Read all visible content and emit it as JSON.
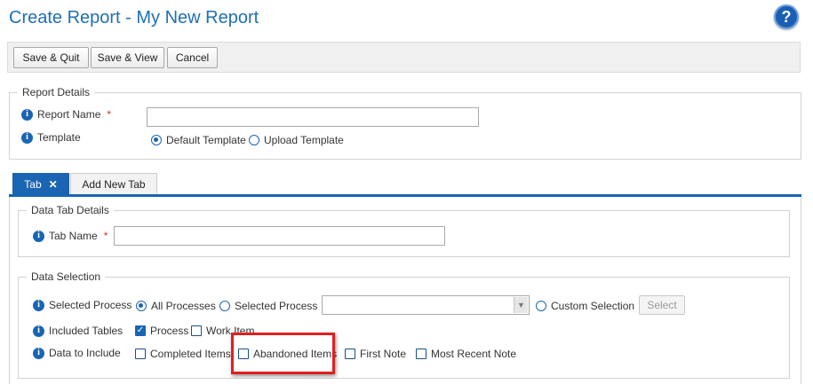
{
  "header": {
    "title": "Create Report - My New Report",
    "help_label": "?"
  },
  "toolbar": {
    "save_quit": "Save & Quit",
    "save_view": "Save & View",
    "cancel": "Cancel"
  },
  "report_details": {
    "legend": "Report Details",
    "name_label": "Report Name",
    "name_value": "",
    "required_mark": "*",
    "template_label": "Template",
    "template_options": [
      "Default Template",
      "Upload Template"
    ],
    "template_selected": "Default Template"
  },
  "tabs": {
    "active_label": "Tab",
    "close_glyph": "✕",
    "add_label": "Add New Tab"
  },
  "data_tab_details": {
    "legend": "Data Tab Details",
    "tab_name_label": "Tab Name",
    "tab_name_value": "",
    "required_mark": "*"
  },
  "data_selection": {
    "legend": "Data Selection",
    "process_label": "Selected Process",
    "process_options": [
      "All Processes",
      "Selected Process",
      "Custom Selection"
    ],
    "process_selected": "All Processes",
    "process_dropdown_value": "",
    "select_button": "Select",
    "tables_label": "Included Tables",
    "tables": [
      {
        "label": "Process",
        "checked": true
      },
      {
        "label": "Work Item",
        "checked": false
      }
    ],
    "include_label": "Data to Include",
    "include": [
      {
        "label": "Completed Items",
        "checked": false
      },
      {
        "label": "Abandoned Items",
        "checked": false
      },
      {
        "label": "First Note",
        "checked": false
      },
      {
        "label": "Most Recent Note",
        "checked": false
      }
    ]
  },
  "colors": {
    "accent": "#1a65b3",
    "title": "#1f6fb5",
    "required": "#d32f2f",
    "highlight": "#e02020"
  }
}
